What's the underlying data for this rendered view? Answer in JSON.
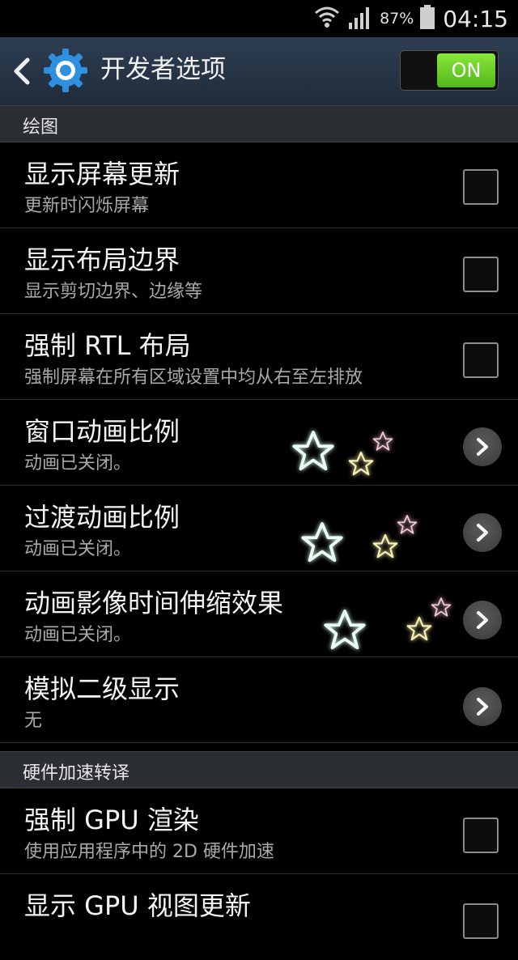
{
  "status_bar": {
    "battery_percent": "87%",
    "time": "04:15"
  },
  "action_bar": {
    "title": "开发者选项",
    "master_toggle": "ON"
  },
  "sections": [
    {
      "header": "绘图",
      "items": [
        {
          "title": "显示屏幕更新",
          "summary": "更新时闪烁屏幕",
          "control": "checkbox",
          "checked": false
        },
        {
          "title": "显示布局边界",
          "summary": "显示剪切边界、边缘等",
          "control": "checkbox",
          "checked": false
        },
        {
          "title": "强制 RTL 布局",
          "summary": "强制屏幕在所有区域设置中均从右至左排放",
          "control": "checkbox",
          "checked": false
        },
        {
          "title": "窗口动画比例",
          "summary": "动画已关闭。",
          "control": "chevron"
        },
        {
          "title": "过渡动画比例",
          "summary": "动画已关闭。",
          "control": "chevron"
        },
        {
          "title": "动画影像时间伸缩效果",
          "summary": "动画已关闭。",
          "control": "chevron"
        },
        {
          "title": "模拟二级显示",
          "summary": "无",
          "control": "chevron"
        }
      ]
    },
    {
      "header": "硬件加速转译",
      "items": [
        {
          "title": "强制 GPU 渲染",
          "summary": "使用应用程序中的 2D 硬件加速",
          "control": "checkbox",
          "checked": false
        },
        {
          "title": "显示 GPU 视图更新",
          "summary": "",
          "control": "checkbox",
          "checked": false
        }
      ]
    }
  ],
  "colors": {
    "action_bar": "#2e3e52",
    "section_header": "#2b2f34",
    "toggle_on": "#6fd42a",
    "gear_blue": "#2f8fe0"
  },
  "icons": [
    "wifi-icon",
    "signal-icon",
    "battery-icon",
    "back-arrow-icon",
    "gear-icon",
    "chevron-right-icon",
    "star-icon"
  ]
}
